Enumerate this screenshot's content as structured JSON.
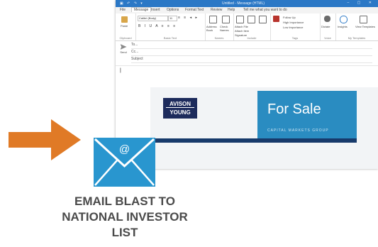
{
  "window": {
    "title": "Untitled - Message (HTML)",
    "tabs": [
      "File",
      "Message",
      "Insert",
      "Options",
      "Format Text",
      "Review",
      "Help",
      "Tell me what you want to do"
    ],
    "active_tab": "Message"
  },
  "ribbon": {
    "groups": [
      "Clipboard",
      "Basic Text",
      "Names",
      "Include",
      "Tags",
      "Voice",
      "My Templates"
    ],
    "paste_label": "Paste",
    "font_name": "Calibri (Body)",
    "font_size": "11",
    "names": [
      "Address Book",
      "Check Names"
    ],
    "include": [
      "Attach File",
      "Attach Item",
      "Signature"
    ],
    "tags": [
      "Follow Up",
      "High Importance",
      "Low Importance"
    ],
    "voice_label": "Dictate",
    "insights_label": "Insights",
    "templates_label": "View Templates"
  },
  "compose": {
    "send_label": "Send",
    "to_label": "To...",
    "cc_label": "Cc...",
    "subject_label": "Subject"
  },
  "flyer": {
    "logo_line1": "AVISON",
    "logo_line2": "YOUNG",
    "headline": "For Sale",
    "subline": "CAPITAL MARKETS GROUP"
  },
  "caption": {
    "line1": "EMAIL BLAST TO",
    "line2": "NATIONAL INVESTOR",
    "line3": "LIST"
  },
  "colors": {
    "arrow": "#e07a26",
    "envelope": "#2996cf",
    "titlebar": "#2b78c6",
    "logo": "#1d2b5c",
    "for_sale_panel": "#2a8cc1",
    "caption_text": "#4a4a4a"
  },
  "icons": [
    "arrow-right-icon",
    "envelope-at-icon",
    "send-icon",
    "paste-icon"
  ]
}
